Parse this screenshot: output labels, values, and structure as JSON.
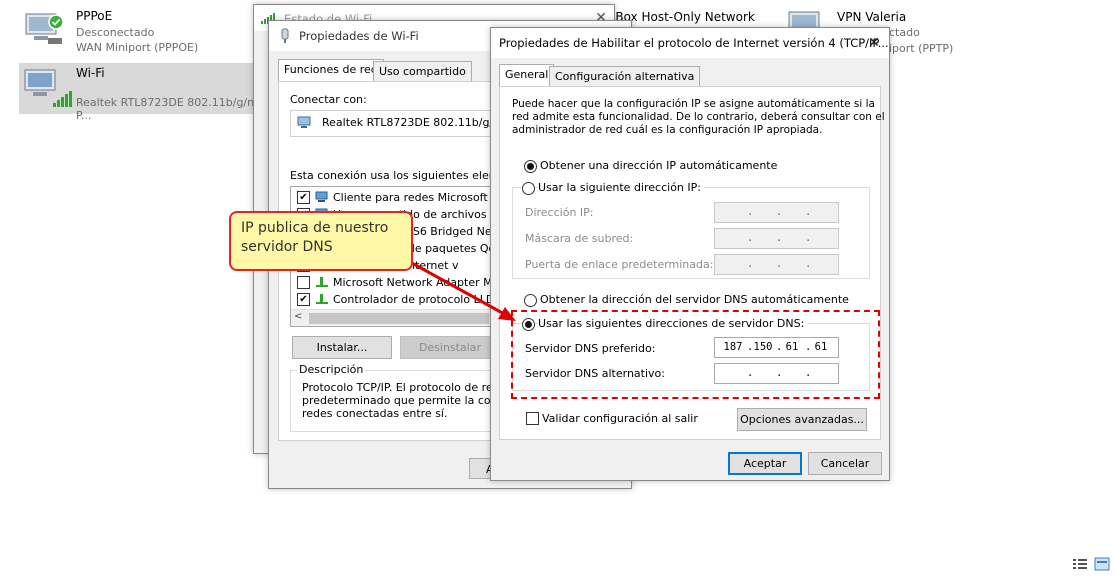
{
  "connections": [
    {
      "name": "PPPoE",
      "status": "Desconectado",
      "device": "WAN Miniport (PPPOE)"
    },
    {
      "name": "Wi-Fi",
      "device": "Realtek RTL8723DE 802.11b/g/n P..."
    },
    {
      "name_partial": "lBox Host-Only Network"
    },
    {
      "name": "VPN Valeria",
      "status_partial": "ctado",
      "device_partial": "iport (PPTP)"
    }
  ],
  "estado_window": {
    "title": "Estado de Wi-Fi"
  },
  "wifi_props": {
    "title": "Propiedades de Wi-Fi",
    "tabs": [
      "Funciones de red",
      "Uso compartido"
    ],
    "connect_label": "Conectar con:",
    "adapter": "Realtek RTL8723DE 802.11b/g/n P",
    "components_label": "Esta conexión usa los siguientes elementos:",
    "components": [
      {
        "checked": true,
        "label": "Cliente para redes Microsoft"
      },
      {
        "checked": true,
        "label": "Uso compartido de archivos e impr"
      },
      {
        "checked": true,
        "label": "VirtualBox NDIS6 Bridged Networ"
      },
      {
        "checked": true,
        "label": "Programador de paquetes QoS"
      },
      {
        "checked": true,
        "label": "Protocolo de Internet v"
      },
      {
        "checked": false,
        "label": "Microsoft Network Adapter Multipl"
      },
      {
        "checked": true,
        "label": "Controlador de protocolo LLDP d"
      }
    ],
    "install_button": "Instalar...",
    "uninstall_button": "Desinstalar",
    "description_label": "Descripción",
    "description_lines": [
      "Protocolo TCP/IP. El protocolo de red d",
      "predeterminado que permite la comunica",
      "redes conectadas entre sí."
    ],
    "ok_partial": "A"
  },
  "ipv4": {
    "title": "Propiedades de Habilitar el protocolo de Internet versión 4 (TCP/IP...",
    "tabs": [
      "General",
      "Configuración alternativa"
    ],
    "intro_lines": [
      "Puede hacer que la configuración IP se asigne automáticamente si la",
      "red admite esta funcionalidad. De lo contrario, deberá consultar con el",
      "administrador de red cuál es la configuración IP apropiada."
    ],
    "ip_auto": "Obtener una dirección IP automáticamente",
    "ip_manual": "Usar la siguiente dirección IP:",
    "ip_address_label": "Dirección IP:",
    "subnet_label": "Máscara de subred:",
    "gateway_label": "Puerta de enlace predeterminada:",
    "dns_auto": "Obtener la dirección del servidor DNS automáticamente",
    "dns_manual": "Usar las siguientes direcciones de servidor DNS:",
    "dns_preferred_label": "Servidor DNS preferido:",
    "dns_preferred": [
      "187",
      "150",
      "61",
      "61"
    ],
    "dns_alternate_label": "Servidor DNS alternativo:",
    "validate_label": "Validar configuración al salir",
    "advanced_button": "Opciones avanzadas...",
    "accept_button": "Aceptar",
    "cancel_button": "Cancelar"
  },
  "callout": {
    "lines": [
      "IP publica de nuestro",
      "servidor DNS"
    ]
  },
  "colors": {
    "annotation_red": "#e00000",
    "callout_fill": "#fff8a6",
    "selection": "#d9d9d9",
    "default_button_border": "#0078d7"
  }
}
